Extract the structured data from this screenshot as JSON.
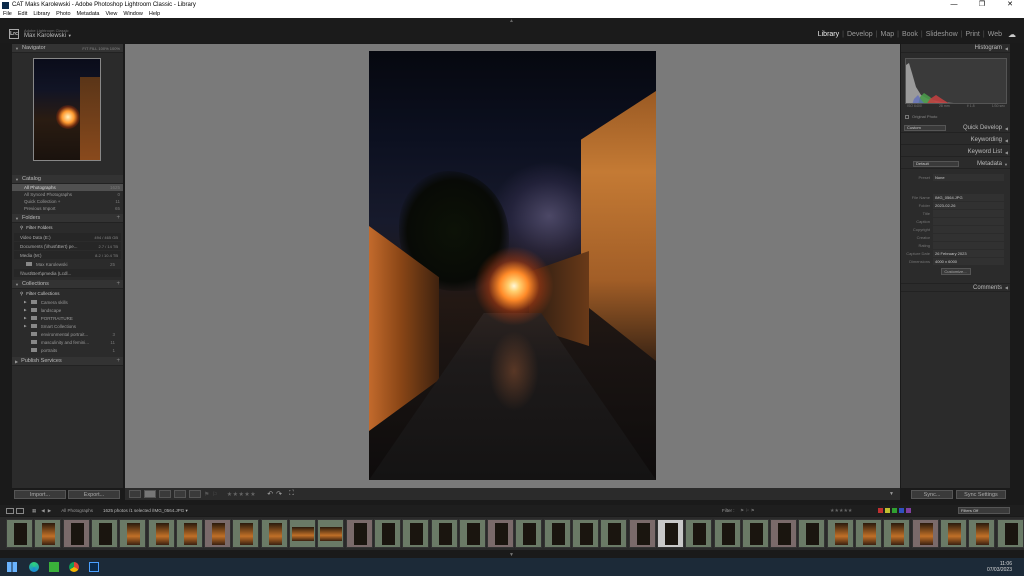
{
  "window": {
    "title": "CAT Maks Karolewski - Adobe Photoshop Lightroom Classic - Library",
    "controls": [
      "—",
      "❐",
      "✕"
    ]
  },
  "menu": [
    "File",
    "Edit",
    "Library",
    "Photo",
    "Metadata",
    "View",
    "Window",
    "Help"
  ],
  "identity": {
    "logo": "Lrc",
    "subtitle": "Adobe Lightroom Classic",
    "user": "Max Karolewski",
    "user_arrow": "▼"
  },
  "modules": [
    "Library",
    "Develop",
    "Map",
    "Book",
    "Slideshow",
    "Print",
    "Web"
  ],
  "left_panel": {
    "navigator": {
      "title": "Navigator",
      "zoom": "FIT  FILL  100%  100%"
    },
    "catalog": {
      "title": "Catalog",
      "items": [
        {
          "label": "All Photographs",
          "count": "1625"
        },
        {
          "label": "All Synced Photographs",
          "count": "0"
        },
        {
          "label": "Quick Collection  +",
          "count": "11"
        },
        {
          "label": "Previous Import",
          "count": "65"
        }
      ]
    },
    "folders": {
      "title": "Folders",
      "add": "+",
      "filter": "Filter Folders",
      "volumes": [
        {
          "label": "Video Data (E:)",
          "info": "494 / 465 GB"
        },
        {
          "label": "Documents (\\\\hust\\Bert) pe...",
          "info": "2.7 / 14 TB"
        },
        {
          "label": "Media (M:)",
          "info": "8.2 / 10.4 TB"
        },
        {
          "label": "\\\\hust\\Bert\\pmedia (Lcdl...",
          "info": ""
        }
      ],
      "subfolder": {
        "label": "Max Karolewski",
        "count": "25"
      }
    },
    "collections": {
      "title": "Collections",
      "add": "+",
      "filter": "Filter Collections",
      "sets": [
        "Camera skills",
        "landscape",
        "PORTRAITURE",
        "Smart Collections"
      ],
      "items": [
        {
          "label": "environmental portrait...",
          "count": "3"
        },
        {
          "label": "masculinity and femini...",
          "count": "11"
        },
        {
          "label": "portraits",
          "count": "1"
        }
      ]
    },
    "publish": {
      "title": "Publish Services",
      "add": "+"
    },
    "import_label": "Import...",
    "export_label": "Export..."
  },
  "right_panel": {
    "histogram": {
      "title": "Histogram",
      "iso": "ISO 6400",
      "focal": "28 mm",
      "aperture": "f/ 1.8",
      "shutter": "1/30 sec"
    },
    "original_photo": "Original Photo",
    "quick_develop": {
      "title": "Quick Develop",
      "preset": "Custom"
    },
    "keywording": "Keywording",
    "keyword_list": "Keyword List",
    "metadata": {
      "title": "Metadata",
      "preset_select": "Default",
      "preset_label": "Preset",
      "preset_value": "None",
      "fields": [
        {
          "key": "File Name",
          "value": "IMG_0564.JPG"
        },
        {
          "key": "Folder",
          "value": "2023-02-26"
        },
        {
          "key": "Title",
          "value": ""
        },
        {
          "key": "Caption",
          "value": ""
        },
        {
          "key": "Copyright",
          "value": ""
        },
        {
          "key": "Creator",
          "value": ""
        },
        {
          "key": "Rating",
          "value": ""
        },
        {
          "key": "Capture Date",
          "value": "26 February 2023"
        },
        {
          "key": "Dimensions",
          "value": "4000 x 6000"
        }
      ],
      "customize": "Customize..."
    },
    "comments": "Comments",
    "sync": "Sync...",
    "sync_settings": "Sync Settings"
  },
  "toolbar": {
    "stars": "★★★★★"
  },
  "filmstrip_bar": {
    "page_nums": "1  2",
    "source": "All Photographs",
    "info": "1625 photos /1 selected /IMG_0564.JPG ▾",
    "filter_label": "Filter :",
    "filters_off": "Filters Off"
  },
  "clock": {
    "time": "11:06",
    "date": "07/03/2023"
  },
  "colors": {
    "panel": "#2b2b2b",
    "center_bg": "#7a7a7a",
    "accent": "#1c2a38"
  },
  "icons": [
    "windows-start-icon",
    "edge-icon",
    "greenshot-icon",
    "chrome-icon",
    "lightroom-icon"
  ]
}
